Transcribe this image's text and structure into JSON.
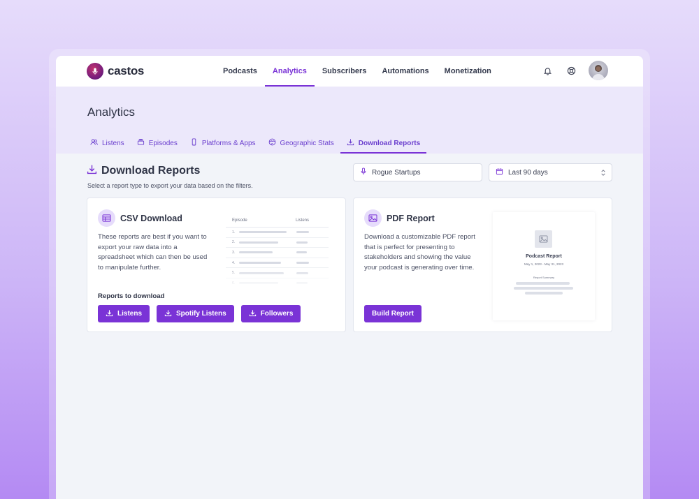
{
  "brand": {
    "name": "castos"
  },
  "nav": {
    "links": [
      {
        "label": "Podcasts",
        "active": false
      },
      {
        "label": "Analytics",
        "active": true
      },
      {
        "label": "Subscribers",
        "active": false
      },
      {
        "label": "Automations",
        "active": false
      },
      {
        "label": "Monetization",
        "active": false
      }
    ]
  },
  "page": {
    "title": "Analytics"
  },
  "tabs": [
    {
      "label": "Listens",
      "icon": "users-icon",
      "active": false
    },
    {
      "label": "Episodes",
      "icon": "stack-icon",
      "active": false
    },
    {
      "label": "Platforms & Apps",
      "icon": "phone-icon",
      "active": false
    },
    {
      "label": "Geographic Stats",
      "icon": "globe-icon",
      "active": false
    },
    {
      "label": "Download Reports",
      "icon": "download-icon",
      "active": true
    }
  ],
  "section": {
    "title": "Download Reports",
    "subtitle": "Select a report type to export your data based on the filters."
  },
  "filters": {
    "podcast": "Rogue Startups",
    "range": "Last 90 days"
  },
  "csv": {
    "title": "CSV Download",
    "description": "These reports are best if you want to export your raw data into a spreadsheet which can then be used to manipulate further.",
    "preview": {
      "col_episode": "Episode",
      "col_listens": "Listens",
      "rows": [
        "1.",
        "2.",
        "3.",
        "4.",
        "5.",
        "6."
      ]
    },
    "reports_label": "Reports to download",
    "buttons": [
      "Listens",
      "Spotify Listens",
      "Followers"
    ]
  },
  "pdf": {
    "title": "PDF Report",
    "description": "Download a customizable PDF report that is perfect for presenting to stakeholders and showing the value your podcast is generating over time.",
    "button": "Build Report",
    "preview": {
      "title": "Podcast Report",
      "date": "May 1, 2023 - May 31, 2023",
      "summary": "Report Summary"
    }
  },
  "colors": {
    "accent": "#7a33d6",
    "header_band": "#ece8fb",
    "page_bg": "#f2f4f9"
  }
}
